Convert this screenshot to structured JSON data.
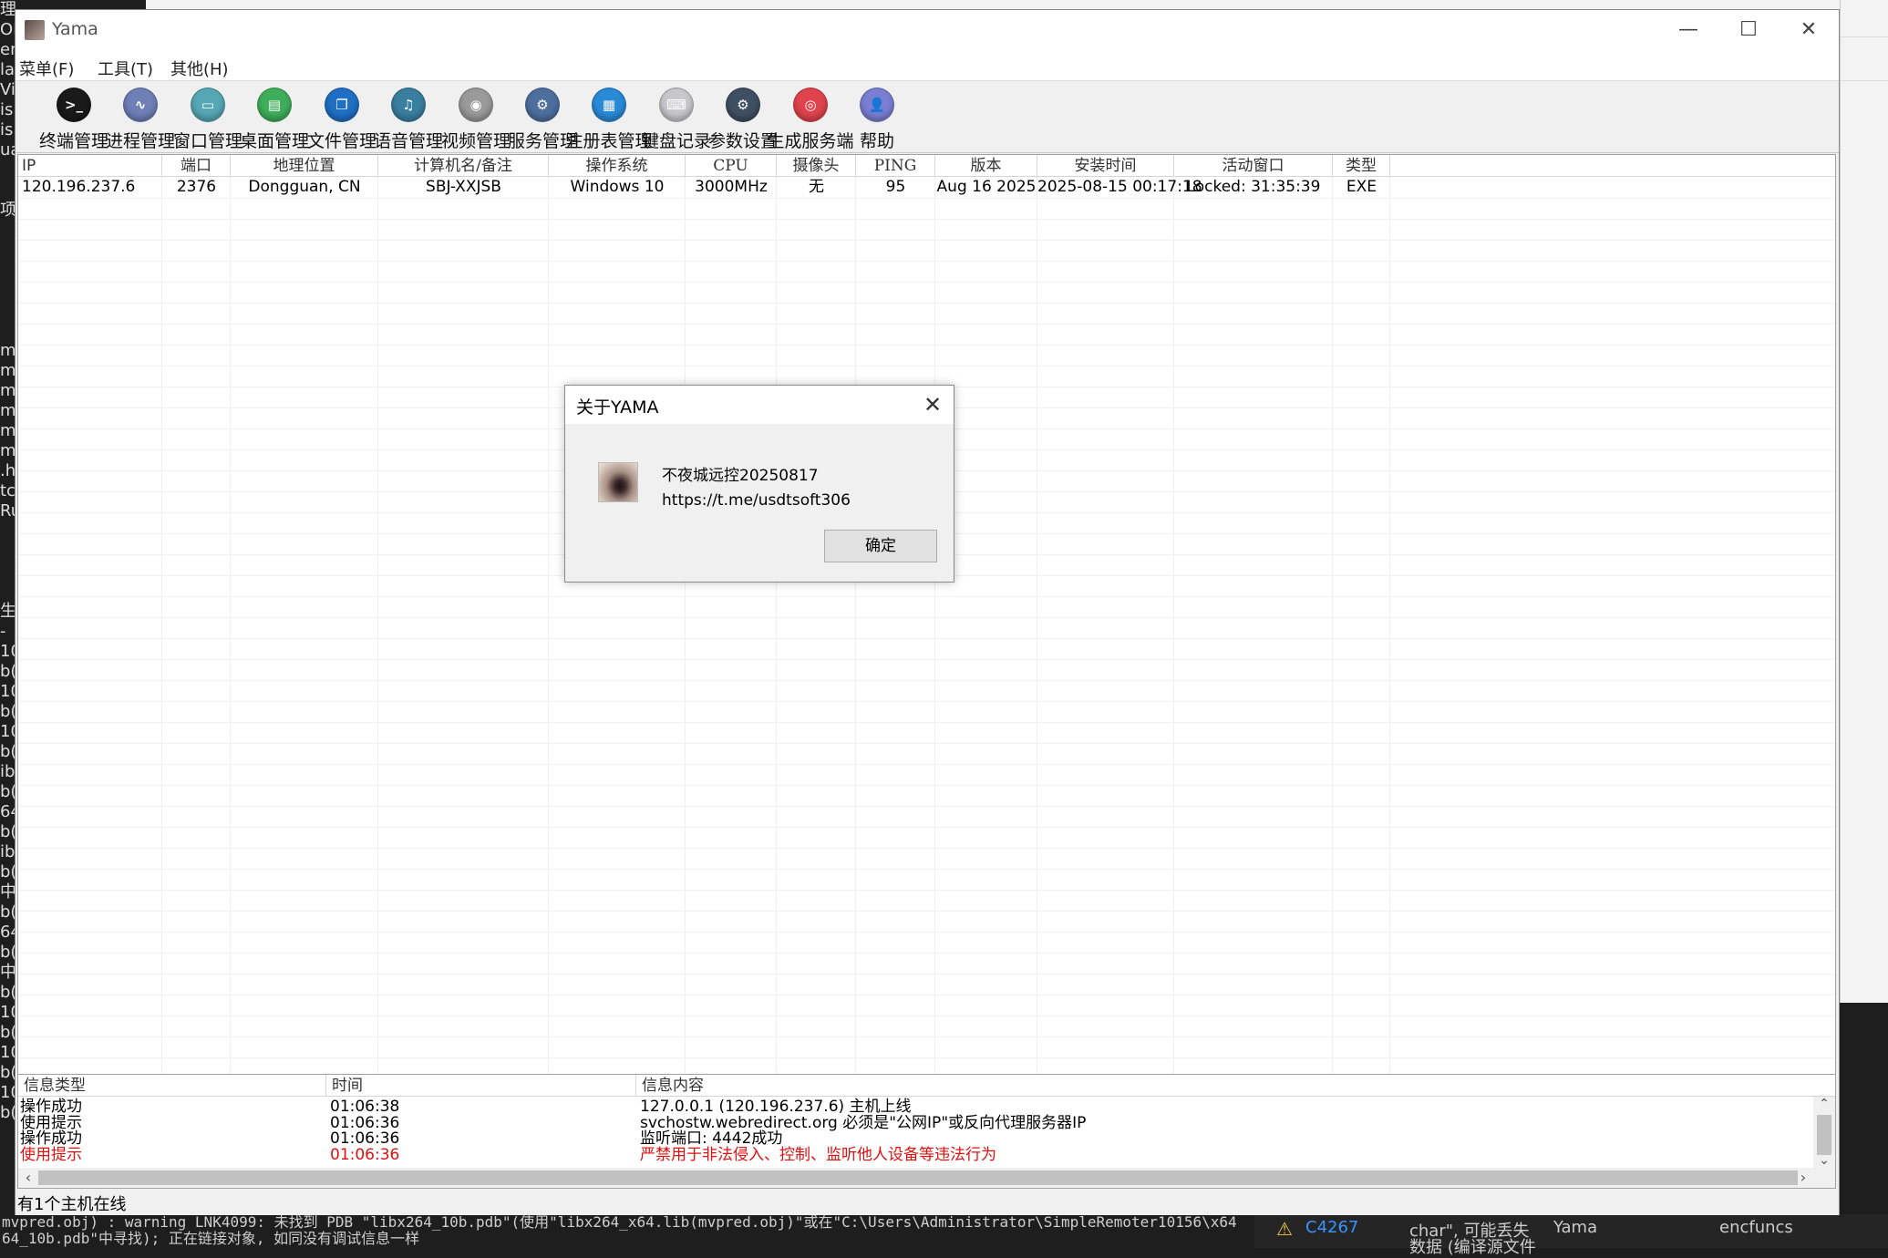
{
  "window": {
    "title": "Yama"
  },
  "menu": [
    "菜单(F)",
    "工具(T)",
    "其他(H)"
  ],
  "toolbar": [
    {
      "label": "终端管理",
      "icon": "terminal-icon",
      "color": "#1a1a1a",
      "glyph": ">_"
    },
    {
      "label": "进程管理",
      "icon": "process-icon",
      "color": "#6f7fb8",
      "glyph": "∿"
    },
    {
      "label": "窗口管理",
      "icon": "window-icon",
      "color": "#56a7b5",
      "glyph": "▭"
    },
    {
      "label": "桌面管理",
      "icon": "desktop-icon",
      "color": "#3fae5a",
      "glyph": "▤"
    },
    {
      "label": "文件管理",
      "icon": "file-icon",
      "color": "#1f6fc4",
      "glyph": "❐"
    },
    {
      "label": "语音管理",
      "icon": "audio-icon",
      "color": "#3a7fa0",
      "glyph": "♫"
    },
    {
      "label": "视频管理",
      "icon": "camera-icon",
      "color": "#9a9a9a",
      "glyph": "◉"
    },
    {
      "label": "服务管理",
      "icon": "service-gear-icon",
      "color": "#4d6f9e",
      "glyph": "⚙"
    },
    {
      "label": "注册表管理",
      "icon": "registry-icon",
      "color": "#2a8ad8",
      "glyph": "▦"
    },
    {
      "label": "键盘记录",
      "icon": "keyboard-icon",
      "color": "#c8c8cc",
      "glyph": "⌨"
    },
    {
      "label": "参数设置",
      "icon": "settings-icon",
      "color": "#3f4f63",
      "glyph": "⚙"
    },
    {
      "label": "生成服务端",
      "icon": "build-server-icon",
      "color": "#e0434d",
      "glyph": "◎"
    },
    {
      "label": "帮助",
      "icon": "help-icon",
      "color": "#7b7fd4",
      "glyph": "👤"
    }
  ],
  "hosts": {
    "columns": [
      "IP",
      "端口",
      "地理位置",
      "计算机名/备注",
      "操作系统",
      "CPU",
      "摄像头",
      "PING",
      "版本",
      "安装时间",
      "活动窗口",
      "类型"
    ],
    "rows": [
      [
        "120.196.237.6",
        "2376",
        "Dongguan, CN",
        "SBJ-XXJSB",
        "Windows 10",
        "3000MHz",
        "无",
        "95",
        "Aug 16 2025",
        "2025-08-15 00:17:18",
        "Locked: 31:35:39",
        "EXE"
      ]
    ]
  },
  "log": {
    "columns": [
      "信息类型",
      "时间",
      "信息内容"
    ],
    "rows": [
      {
        "type": "操作成功",
        "time": "01:06:38",
        "content": "127.0.0.1 (120.196.237.6) 主机上线",
        "color": "#000000"
      },
      {
        "type": "使用提示",
        "time": "01:06:36",
        "content": "svchostw.webredirect.org 必须是\"公网IP\"或反向代理服务器IP",
        "color": "#000000"
      },
      {
        "type": "操作成功",
        "time": "01:06:36",
        "content": "监听端口: 4442成功",
        "color": "#000000"
      },
      {
        "type": "使用提示",
        "time": "01:06:36",
        "content": "严禁用于非法侵入、控制、监听他人设备等违法行为",
        "color": "#e01010"
      }
    ]
  },
  "status": "有1个主机在线",
  "dialog": {
    "title": "关于YAMA",
    "line1": "不夜城远控20250817",
    "line2": "https://t.me/usdtsoft306",
    "ok": "确定"
  },
  "background": {
    "left_chars": [
      "理",
      "OR",
      "en",
      "la",
      "Vis",
      "isi",
      "isi",
      "ua",
      "",
      "",
      "项",
      "",
      "",
      "",
      "",
      "",
      "",
      "m",
      "m",
      "m",
      "m",
      "m",
      "m",
      ".h",
      "tc",
      "Ru",
      "",
      "",
      "",
      "",
      "生",
      "-",
      "10",
      "b(",
      "10",
      "b(",
      "10",
      "b(",
      "ib",
      "b(",
      "64",
      "b(",
      "ib",
      "b(",
      "中",
      "b(",
      "64",
      "b(",
      "中",
      "b(",
      "10",
      "b(",
      "10",
      "b(",
      "10",
      "b("
    ],
    "output_line1": "mvpred.obj) : warning LNK4099: 未找到 PDB \"libx264_10b.pdb\"(使用\"libx264_x64.lib(mvpred.obj)\"或在\"C:\\Users\\Administrator\\SimpleRemoter10156\\x64",
    "output_line2": "64_10b.pdb\"中寻找); 正在链接对象, 如同没有调试信息一样",
    "error_code": "C4267",
    "error_text1": "char\", 可能丢失",
    "error_text2": "数据 (编译源文件",
    "error_project": "Yama",
    "error_file": "encfuncs"
  }
}
